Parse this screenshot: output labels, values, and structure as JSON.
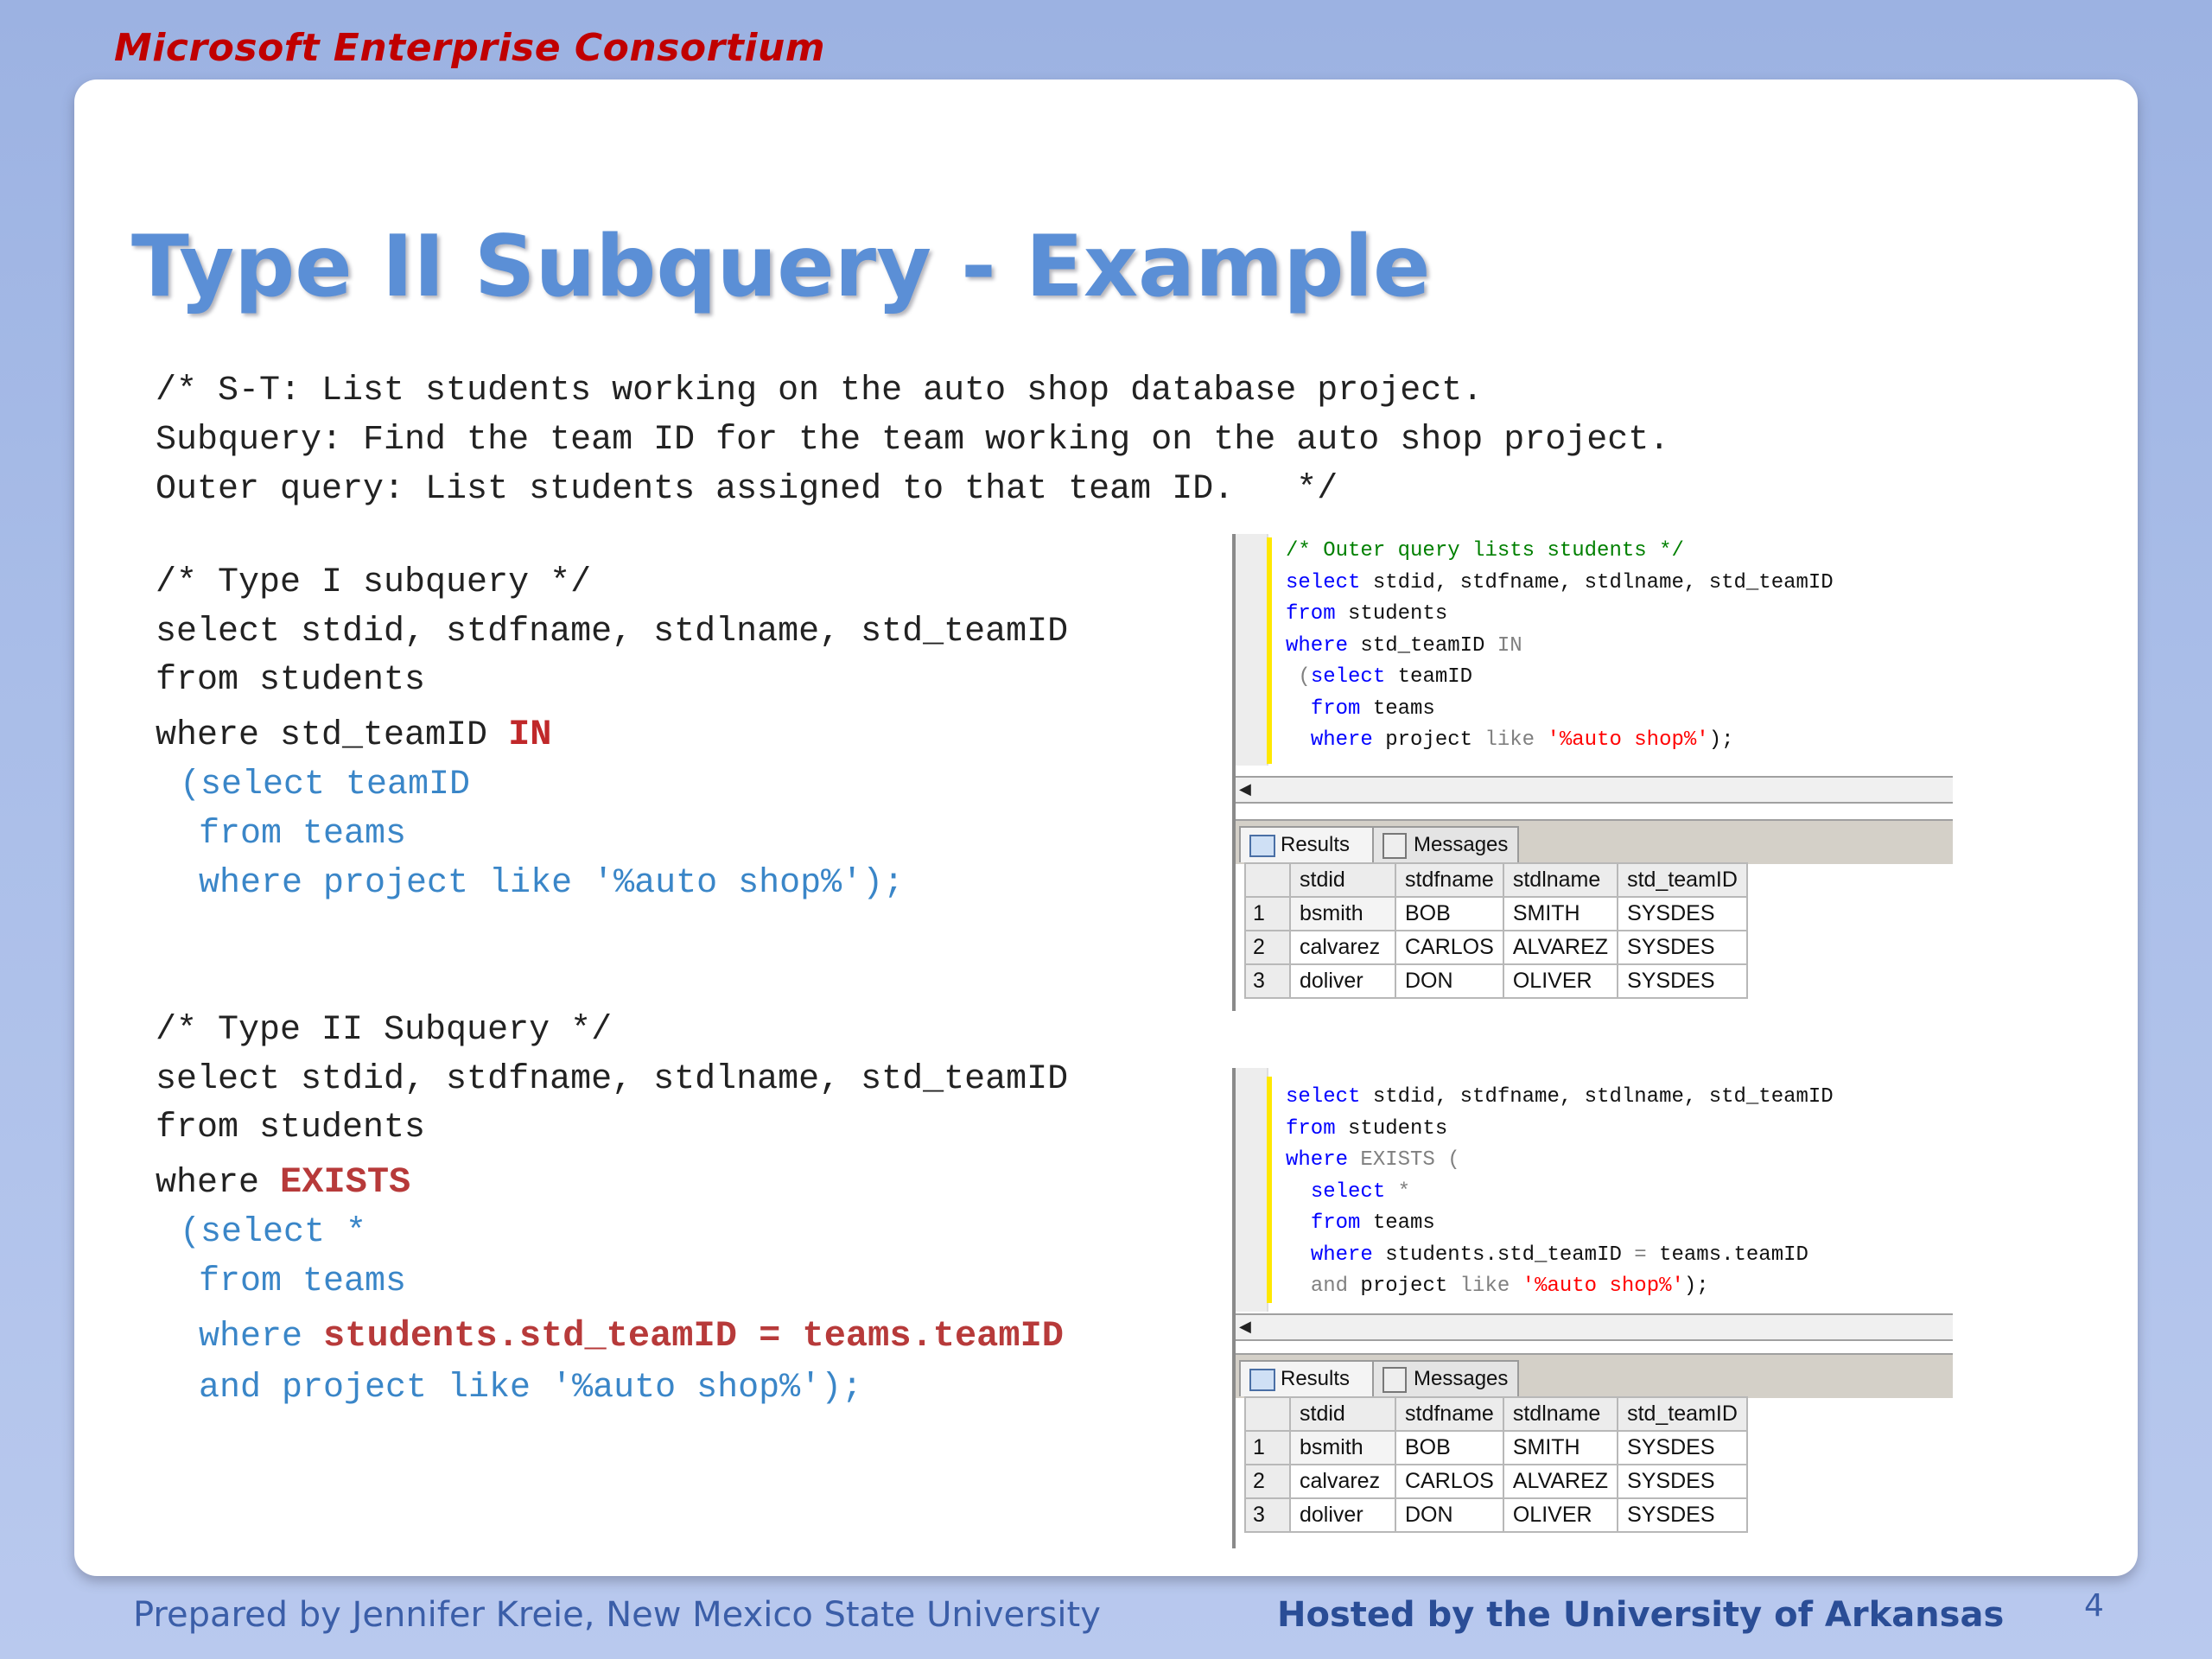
{
  "header": {
    "consortium": "Microsoft Enterprise Consortium"
  },
  "slide": {
    "title": "Type II Subquery - Example",
    "intro": [
      "/* S-T: List students working on the auto shop database project.",
      "Subquery: Find the team ID for the team working on the auto shop project.",
      "Outer query: List students assigned to that team ID.   */"
    ],
    "type1": {
      "comment": "/* Type I subquery */",
      "line1": "select stdid, stdfname, stdlname, std_teamID",
      "line2": "from students",
      "line3_pre": "where std_teamID ",
      "line3_kw": "IN",
      "line4": "(select teamID",
      "line5": "from teams",
      "line6": "where project like '%auto shop%');"
    },
    "type2": {
      "comment": "/* Type II Subquery */",
      "line1": "select stdid, stdfname, stdlname, std_teamID",
      "line2": "from students",
      "line3_pre": "where ",
      "line3_kw": "EXISTS",
      "line4": "(select *",
      "line5": "from teams",
      "line6_pre": "where ",
      "line6_kw": "students.std_teamID = teams.teamID",
      "line7": "and project like '%auto shop%');"
    }
  },
  "screenshot1": {
    "code": {
      "l1": "/* Outer query lists students */",
      "l2_kw": "select",
      "l2": " stdid, stdfname, stdlname, std_teamID",
      "l3_kw": "from",
      "l3": " students",
      "l4_kw": "where",
      "l4": " std_teamID ",
      "l4_gr": "IN",
      "l5_gr": " (",
      "l5_kw": "select",
      "l5": " teamID",
      "l6_kw": "from",
      "l6": " teams",
      "l7_kw": "where",
      "l7": " project ",
      "l7_gr": "like",
      "l7_st": " '%auto shop%'",
      "l7_end": ");"
    },
    "tabs": {
      "results": "Results",
      "messages": "Messages"
    },
    "columns": [
      "stdid",
      "stdfname",
      "stdlname",
      "std_teamID"
    ],
    "rows": [
      [
        "1",
        "bsmith",
        "BOB",
        "SMITH",
        "SYSDES"
      ],
      [
        "2",
        "calvarez",
        "CARLOS",
        "ALVAREZ",
        "SYSDES"
      ],
      [
        "3",
        "doliver",
        "DON",
        "OLIVER",
        "SYSDES"
      ]
    ]
  },
  "screenshot2": {
    "code": {
      "l1_kw": "select",
      "l1": " stdid, stdfname, stdlname, std_teamID",
      "l2_kw": "from",
      "l2": " students",
      "l3_kw": "where",
      "l3_gr": " EXISTS (",
      "l4_kw": "select",
      "l4_gr": " *",
      "l5_kw": "from",
      "l5": " teams",
      "l6_kw": "where",
      "l6": " students.std_teamID ",
      "l6_gr": "=",
      "l6b": " teams.teamID",
      "l7_gr": "and",
      "l7": " project ",
      "l7_gr2": "like",
      "l7_st": " '%auto shop%'",
      "l7_end": ");"
    },
    "tabs": {
      "results": "Results",
      "messages": "Messages"
    },
    "columns": [
      "stdid",
      "stdfname",
      "stdlname",
      "std_teamID"
    ],
    "rows": [
      [
        "1",
        "bsmith",
        "BOB",
        "SMITH",
        "SYSDES"
      ],
      [
        "2",
        "calvarez",
        "CARLOS",
        "ALVAREZ",
        "SYSDES"
      ],
      [
        "3",
        "doliver",
        "DON",
        "OLIVER",
        "SYSDES"
      ]
    ]
  },
  "footer": {
    "left": "Prepared by Jennifer Kreie, New Mexico State University",
    "right": "Hosted by the University of Arkansas",
    "page": "4"
  }
}
